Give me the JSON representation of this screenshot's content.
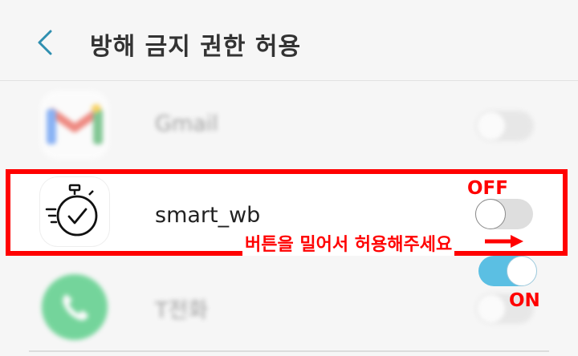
{
  "header": {
    "back_icon": "chevron-left-icon",
    "title": "방해 금지 권한 허용"
  },
  "apps": [
    {
      "name": "Gmail",
      "icon": "gmail-icon",
      "toggle": "off",
      "blurred": true
    },
    {
      "name": "smart_wb",
      "icon": "stopwatch-check-icon",
      "toggle": "off",
      "blurred": false
    },
    {
      "name": "T전화",
      "icon": "phone-icon",
      "toggle": "off",
      "blurred": true
    }
  ],
  "annotation": {
    "off_label": "OFF",
    "on_label": "ON",
    "instruction": "버튼을 밀어서 허용해주세요",
    "arrow_icon": "right-arrow-icon",
    "demo_toggle_state": "on",
    "highlight_color": "#ff0000"
  },
  "colors": {
    "toggle_on": "#5bbfe3",
    "toggle_off": "#dedede",
    "accent": "#2f8fb0"
  }
}
